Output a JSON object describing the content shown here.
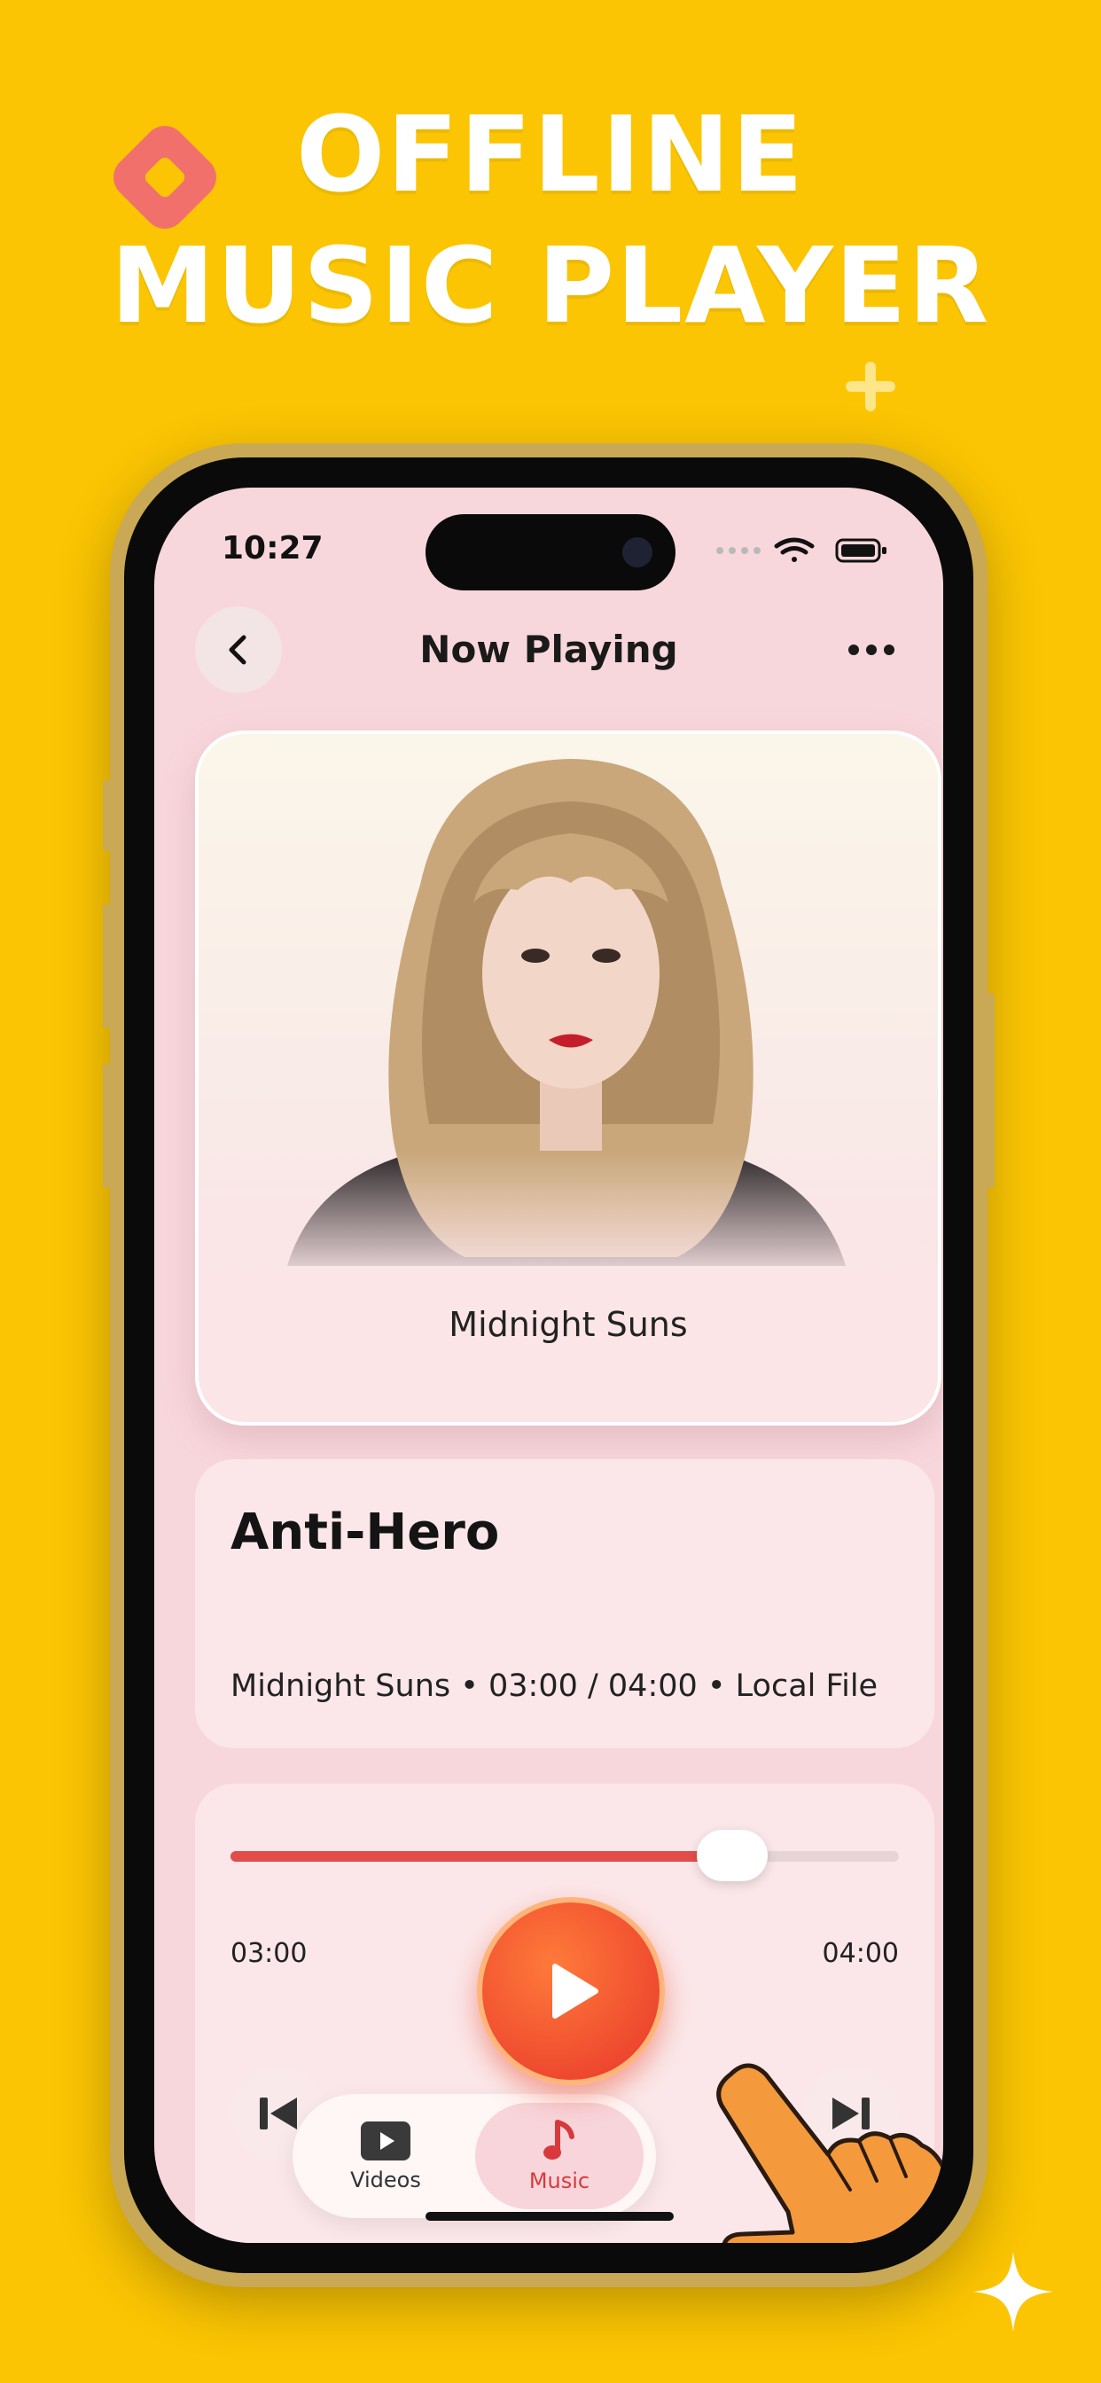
{
  "promo": {
    "headline_line1": "OFFLINE",
    "headline_line2": "MUSIC PLAYER",
    "background_color": "#FBC503"
  },
  "status_bar": {
    "time": "10:27",
    "icons": [
      "signal-dots-icon",
      "wifi-icon",
      "battery-icon"
    ]
  },
  "header": {
    "back_icon": "chevron-left-icon",
    "title": "Now Playing",
    "more_icon": "ellipsis-icon"
  },
  "album": {
    "name": "Midnight Suns",
    "art": "artist-portrait"
  },
  "track": {
    "title": "Anti-Hero",
    "meta": "Midnight Suns • 03:00 / 04:00 • Local File"
  },
  "player": {
    "current_time": "03:00",
    "total_time": "04:00",
    "progress": 0.75,
    "accent_color": "#E24D4A",
    "play_icon": "play-icon",
    "prev_icon": "skip-previous-icon",
    "next_icon": "skip-next-icon"
  },
  "tabs": [
    {
      "label": "Videos",
      "icon": "video-play-icon",
      "active": false
    },
    {
      "label": "Music",
      "icon": "music-note-icon",
      "active": true
    }
  ]
}
